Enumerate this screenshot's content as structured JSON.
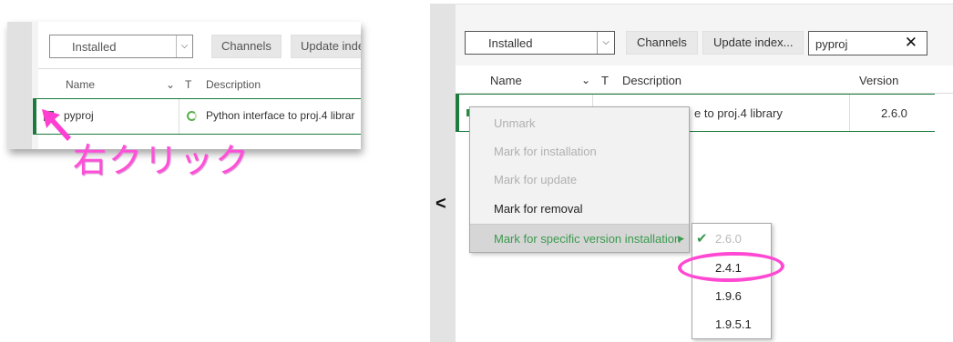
{
  "left_panel": {
    "toolbar": {
      "filter_value": "Installed",
      "channels_label": "Channels",
      "update_index_label": "Update inde"
    },
    "columns": {
      "name": "Name",
      "type": "T",
      "description": "Description"
    },
    "row": {
      "name": "pyproj",
      "description": "Python interface to proj.4 librar"
    },
    "annotation": "右クリック"
  },
  "main_panel": {
    "toolbar": {
      "filter_value": "Installed",
      "channels_label": "Channels",
      "update_index_label": "Update index...",
      "search_value": "pyproj",
      "clear_label": "✕"
    },
    "columns": {
      "name": "Name",
      "type": "T",
      "description": "Description",
      "version": "Version"
    },
    "row": {
      "description_tail": "e to proj.4 library",
      "version": "2.6.0"
    },
    "context_menu": {
      "items": [
        {
          "label": "Unmark"
        },
        {
          "label": "Mark for installation"
        },
        {
          "label": "Mark for update"
        },
        {
          "label": "Mark for removal"
        },
        {
          "label": "Mark for specific version installation"
        }
      ]
    },
    "version_submenu": {
      "items": [
        {
          "label": "2.6.0"
        },
        {
          "label": "2.4.1"
        },
        {
          "label": "1.9.6"
        },
        {
          "label": "1.9.5.1"
        }
      ]
    }
  },
  "colors": {
    "accent_green": "#1c7a3e",
    "highlight_pink": "#ff49d2"
  }
}
